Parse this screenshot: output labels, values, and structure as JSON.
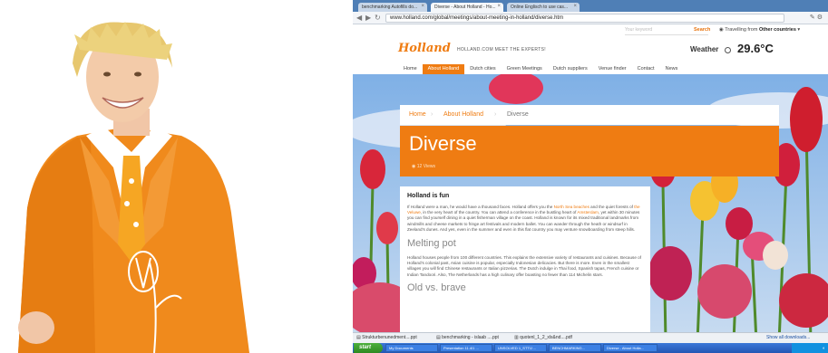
{
  "browser": {
    "tabs": [
      {
        "label": "benchmarking Autofills do...",
        "active": false
      },
      {
        "label": "Diverse - About Holland - Ho...",
        "active": true
      },
      {
        "label": "Online Englisch to use cas...",
        "active": false
      }
    ],
    "url": "www.holland.com/global/meetings/about-meeting-in-holland/diverse.htm"
  },
  "site": {
    "search_placeholder": "Your keyword",
    "search_label": "Search",
    "travel_prefix": "Travelling from",
    "travel_country": "Other countries",
    "logo": "Holland",
    "tagline": "HOLLAND.COM MEET THE EXPERTS!",
    "weather_label": "Weather",
    "temperature": "29.6°C",
    "menu": [
      {
        "label": "Home",
        "active": false
      },
      {
        "label": "About Holland",
        "active": true
      },
      {
        "label": "Dutch cities",
        "active": false
      },
      {
        "label": "Green Meetings",
        "active": false
      },
      {
        "label": "Dutch suppliers",
        "active": false
      },
      {
        "label": "Venue finder",
        "active": false
      },
      {
        "label": "Contact",
        "active": false
      },
      {
        "label": "News",
        "active": false
      }
    ],
    "breadcrumb": [
      "Home",
      "About Holland",
      "Diverse"
    ],
    "page_title": "Diverse",
    "views": "12 Views",
    "article": {
      "heading": "Holland is fun",
      "p1_a": "If Holland were a man, he would have a thousand faces. Holland offers you the ",
      "p1_link1": "North Sea beaches",
      "p1_b": " and the quiet forests of ",
      "p1_link2": "the Veluwe",
      "p1_c": ", in the very heart of the country. You can attend a conference in the bustling heart of ",
      "p1_link3": "Amsterdam",
      "p1_d": ", yet within 30 minutes you can find yourself dining in a quiet fisherman village on the coast. Holland is known for its mixed traditional landmarks from windmills and cheese markets to fringe art festivals and modern ballet. You can wander through the heath or windsurf in Zeeland's dunes. And yes, even in the summer and even in this flat country you may venture snowboarding from steep hills.",
      "subheading": "Melting pot",
      "p2": "Holland houses people from 100 different countries. This explains the extensive variety of restaurants and cuisines. Because of Holland's colonial past, Asian cuisine is popular, especially Indonesian delicacies. But there is more. Even in the smallest villages you will find Chinese restaurants or Italian pizzerias. The Dutch indulge in Thai food, Spanish tapas, French cuisine or Indian Tandoori. Also, The Netherlands has a high culinary offer boasting no fewer than 114 Michelin stars.",
      "subheading2": "Old vs. brave"
    }
  },
  "downloads": [
    {
      "label": "Strukturbenunedment....ppt"
    },
    {
      "label": "benchmarking - islaab ....ppt"
    },
    {
      "label": "quotenl_1_2_xls&nd....pdf"
    }
  ],
  "downloads_all": "Show all downloads...",
  "taskbar": {
    "start": "start",
    "items": [
      "My Documents",
      "Presentation 11.4/1 ...",
      "UNSOLVED 1_STTIJ ...",
      "BENCHMARKING...",
      "Diverse - About Holla..."
    ]
  },
  "colors": {
    "accent": "#ef7c12",
    "suit": "#f08a1c"
  }
}
